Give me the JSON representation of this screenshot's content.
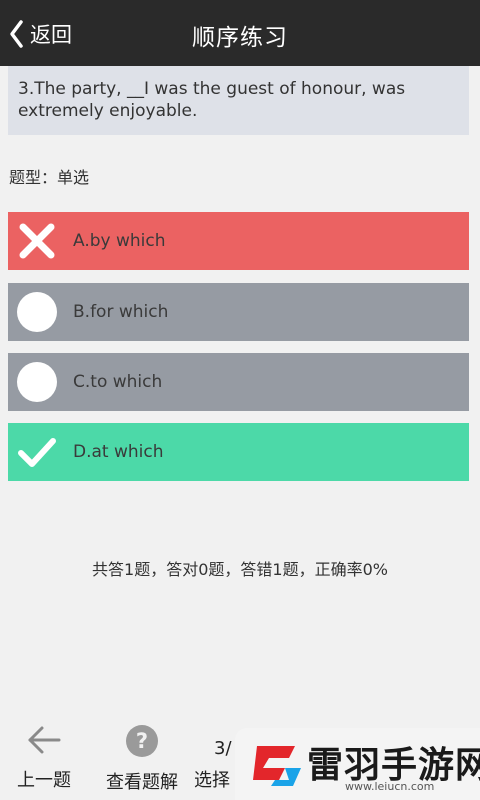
{
  "header": {
    "back_label": "返回",
    "title": "顺序练习"
  },
  "question": {
    "text": "3.The party, __I was the guest of honour, was extremely enjoyable.",
    "type_label": "题型：单选"
  },
  "options": [
    {
      "label": "A.by which",
      "state": "wrong",
      "color": "#eb6262",
      "icon": "cross-icon"
    },
    {
      "label": "B.for which",
      "state": "neutral",
      "color": "#969ba3",
      "icon": "circle-icon"
    },
    {
      "label": "C.to which",
      "state": "neutral",
      "color": "#969ba3",
      "icon": "circle-icon"
    },
    {
      "label": "D.at which",
      "state": "correct",
      "color": "#4cd9a8",
      "icon": "check-icon"
    }
  ],
  "stats": "共答1题，答对0题，答错1题，正确率0%",
  "bottom_bar": {
    "prev_label": "上一题",
    "analysis_label": "查看题解",
    "select_label": "选择",
    "counter": "3/"
  },
  "watermark": {
    "text": "雷羽手游网",
    "url": "www.leiucn.com"
  }
}
